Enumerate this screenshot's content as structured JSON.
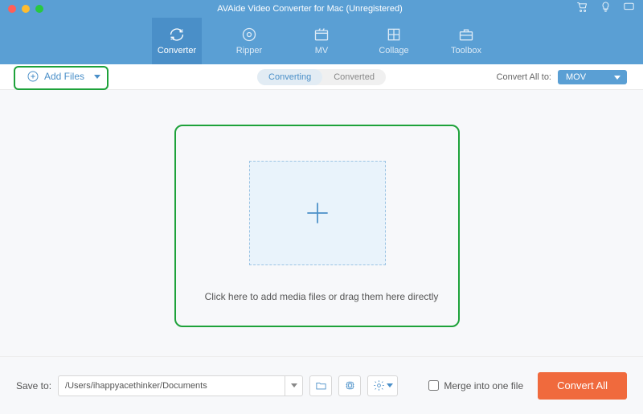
{
  "title": "AVAide Video Converter for Mac (Unregistered)",
  "nav": {
    "converter": "Converter",
    "ripper": "Ripper",
    "mv": "MV",
    "collage": "Collage",
    "toolbox": "Toolbox"
  },
  "subbar": {
    "add_files": "Add Files",
    "tab_converting": "Converting",
    "tab_converted": "Converted",
    "convert_all_to": "Convert All to:",
    "format": "MOV"
  },
  "drop_hint": "Click here to add media files or drag them here directly",
  "footer": {
    "save_to": "Save to:",
    "path": "/Users/ihappyacethinker/Documents",
    "merge": "Merge into one file",
    "convert_all": "Convert All"
  }
}
